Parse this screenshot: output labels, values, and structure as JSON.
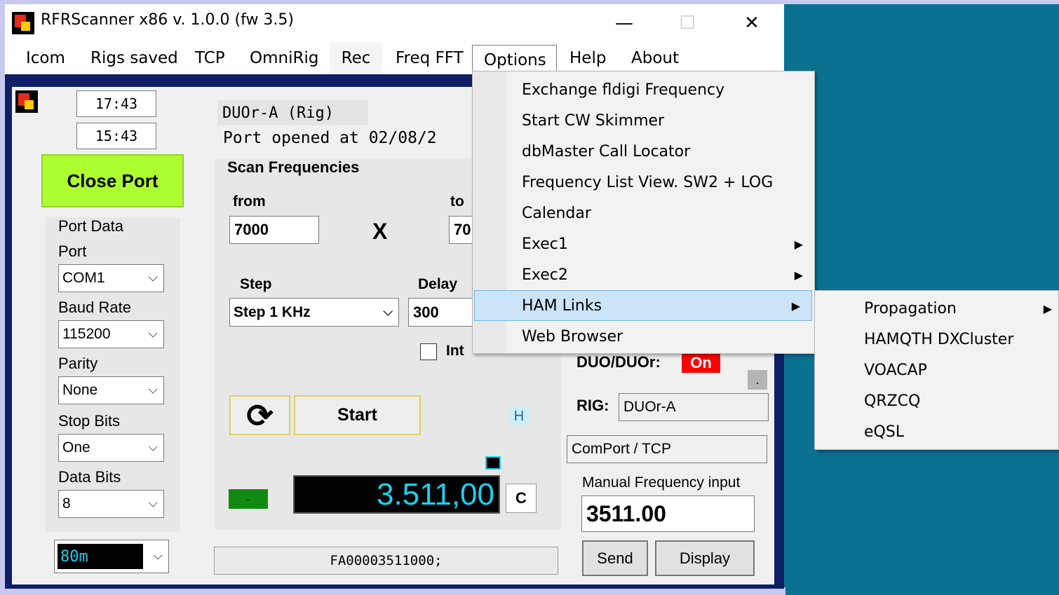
{
  "window": {
    "title": "RFRScanner  x86 v. 1.0.0  (fw 3.5)",
    "minimize": "—",
    "maximize": "☐",
    "close": "✕"
  },
  "menubar": [
    {
      "label": "Icom"
    },
    {
      "label": "Rigs saved"
    },
    {
      "label": "TCP"
    },
    {
      "label": "OmniRig"
    },
    {
      "label": "Rec"
    },
    {
      "label": "Freq FFT"
    },
    {
      "label": "Options"
    },
    {
      "label": "Help"
    },
    {
      "label": "About"
    }
  ],
  "left": {
    "time1": "17:43",
    "time2": "15:43",
    "close_port": "Close Port",
    "port_data_title": "Port Data",
    "port_label": "Port",
    "port_value": "COM1",
    "baud_label": "Baud Rate",
    "baud_value": "115200",
    "parity_label": "Parity",
    "parity_value": "None",
    "stop_label": "Stop Bits",
    "stop_value": "One",
    "data_label": "Data Bits",
    "data_value": "8",
    "band_value": "80m"
  },
  "center": {
    "rig_name": "DUOr-A (Rig)",
    "port_opened": "Port opened at 02/08/2",
    "scan_title": "Scan Frequencies",
    "from_label": "from",
    "from_value": "7000",
    "to_label": "to",
    "to_value": "70",
    "x_label": "X",
    "step_label": "Step",
    "step_value": "Step  1 KHz",
    "delay_label": "Delay",
    "delay_value": "300",
    "int_label": "Int",
    "start_label": "Start",
    "refresh_icon": "⟳",
    "h_label": "H",
    "minus_label": "-",
    "freq_display": "3.511,00",
    "c_label": "C",
    "command": "FA00003511000;"
  },
  "right": {
    "duo_label": "DUO/DUOr:",
    "duo_status": "On",
    "dot_button": ".",
    "rig_label": "RIG:",
    "rig_value": "DUOr-A",
    "comport_value": "ComPort / TCP",
    "manual_label": "Manual Frequency input",
    "manual_value": "3511.00",
    "send_label": "Send",
    "display_label": "Display"
  },
  "options_menu": [
    {
      "label": "Exchange fldigi Frequency",
      "submenu": false
    },
    {
      "label": "Start CW Skimmer",
      "submenu": false
    },
    {
      "label": "dbMaster Call Locator",
      "submenu": false
    },
    {
      "label": "Frequency List View. SW2 + LOG",
      "submenu": false
    },
    {
      "label": "Calendar",
      "submenu": false
    },
    {
      "label": "Exec1",
      "submenu": true
    },
    {
      "label": "Exec2",
      "submenu": true
    },
    {
      "label": "HAM Links",
      "submenu": true,
      "highlighted": true
    },
    {
      "label": "Web Browser",
      "submenu": false
    }
  ],
  "ham_links_submenu": [
    {
      "label": "Propagation",
      "submenu": true
    },
    {
      "label": "HAMQTH DXCluster",
      "submenu": false
    },
    {
      "label": "VOACAP",
      "submenu": false
    },
    {
      "label": "QRZCQ",
      "submenu": false
    },
    {
      "label": "eQSL",
      "submenu": false
    }
  ],
  "colors": {
    "desktop": "#0b7191",
    "client_bg": "#0e1f66",
    "close_port_bg": "#adff2f",
    "freq_text": "#19d0f0",
    "on_badge": "#ff0000",
    "menu_highlight": "#cce4f7"
  }
}
